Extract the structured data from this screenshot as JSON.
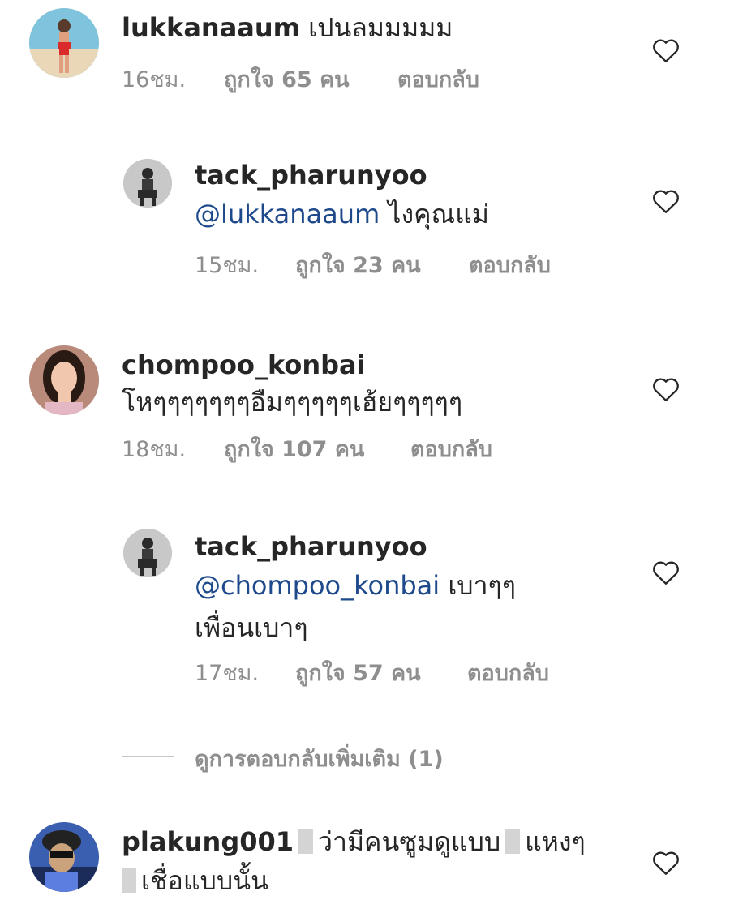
{
  "comments": [
    {
      "username": "lukkanaaum",
      "text": "เปนลมมมมม",
      "time": "16ชม.",
      "likes": "ถูกใจ 65 คน",
      "reply": "ตอบกลับ"
    },
    {
      "username": "tack_pharunyoo",
      "mention": "@lukkanaaum",
      "text": " ไงคุณแม่",
      "time": "15ชม.",
      "likes": "ถูกใจ 23 คน",
      "reply": "ตอบกลับ"
    },
    {
      "username": "chompoo_konbai",
      "text": "โหๆๆๆๆๆๆๆอืมๆๆๆๆๆเฮ้ยๆๆๆๆๆ",
      "time": "18ชม.",
      "likes": "ถูกใจ 107 คน",
      "reply": "ตอบกลับ"
    },
    {
      "username": "tack_pharunyoo",
      "mention": "@chompoo_konbai",
      "text": " เบาๆๆ",
      "text2": "เพื่อนเบาๆ",
      "time": "17ชม.",
      "likes": "ถูกใจ 57 คน",
      "reply": "ตอบกลับ"
    },
    {
      "username": "plakung001",
      "text_a": "ว่ามีคนซูมดูแบบ",
      "text_b": "แหงๆ",
      "text2": "เชื่อแบบนั้น"
    }
  ],
  "view_more_replies": "ดูการตอบกลับเพิ่มเติม (1)",
  "icons": {
    "like": "heart-outline-icon"
  },
  "colors": {
    "mention": "#1e4a8c",
    "meta": "#8e8e8e",
    "text": "#262626"
  }
}
